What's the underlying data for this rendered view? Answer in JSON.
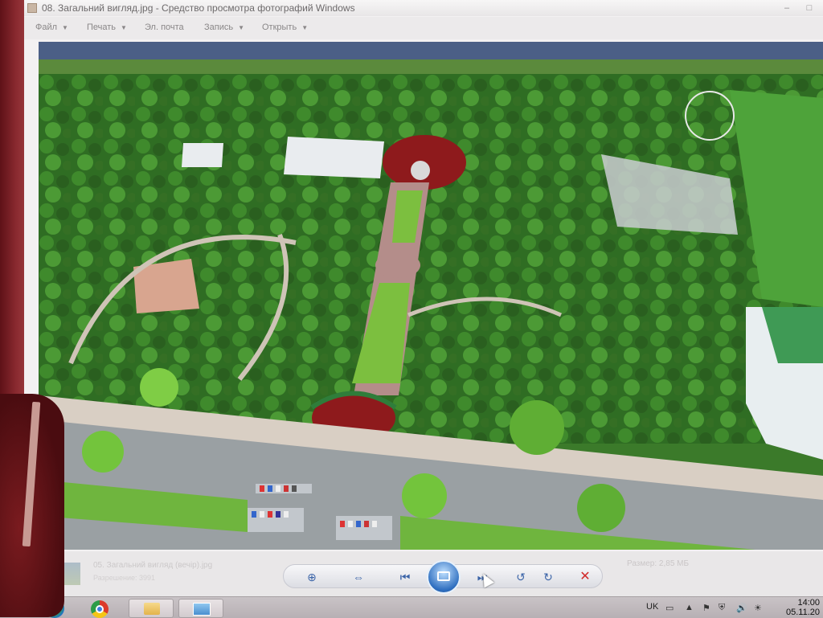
{
  "window": {
    "title": "08. Загальний вигляд.jpg - Средство просмотра фотографий Windows",
    "controls": {
      "minimize": "–",
      "maximize": "□"
    }
  },
  "menu": [
    {
      "label": "Файл",
      "arrow": "▼"
    },
    {
      "label": "Печать",
      "arrow": "▼"
    },
    {
      "label": "Эл. почта",
      "arrow": ""
    },
    {
      "label": "Запись",
      "arrow": "▼"
    },
    {
      "label": "Открыть",
      "arrow": "▼"
    }
  ],
  "viewer": {
    "image_subject": "aerial-park-plan-render"
  },
  "filmstrip": {
    "name": "05. Загальний вигляд (вечір).jpg",
    "sub": "Разрешение: 3991",
    "size": "Размер: 2,85 МБ"
  },
  "controls": {
    "zoom": "⊕",
    "fit": "⇔",
    "prev": "⏮",
    "slideshow": "slideshow",
    "next": "⏭",
    "rotate_ccw": "↺",
    "rotate_cw": "↻",
    "delete": "✕"
  },
  "taskbar": {
    "language": "UK",
    "time": "14:00",
    "date": "05.11.20"
  },
  "colors": {
    "frame": "#7a1f25",
    "accent": "#2f6fc0",
    "delete": "#d12a2a"
  }
}
